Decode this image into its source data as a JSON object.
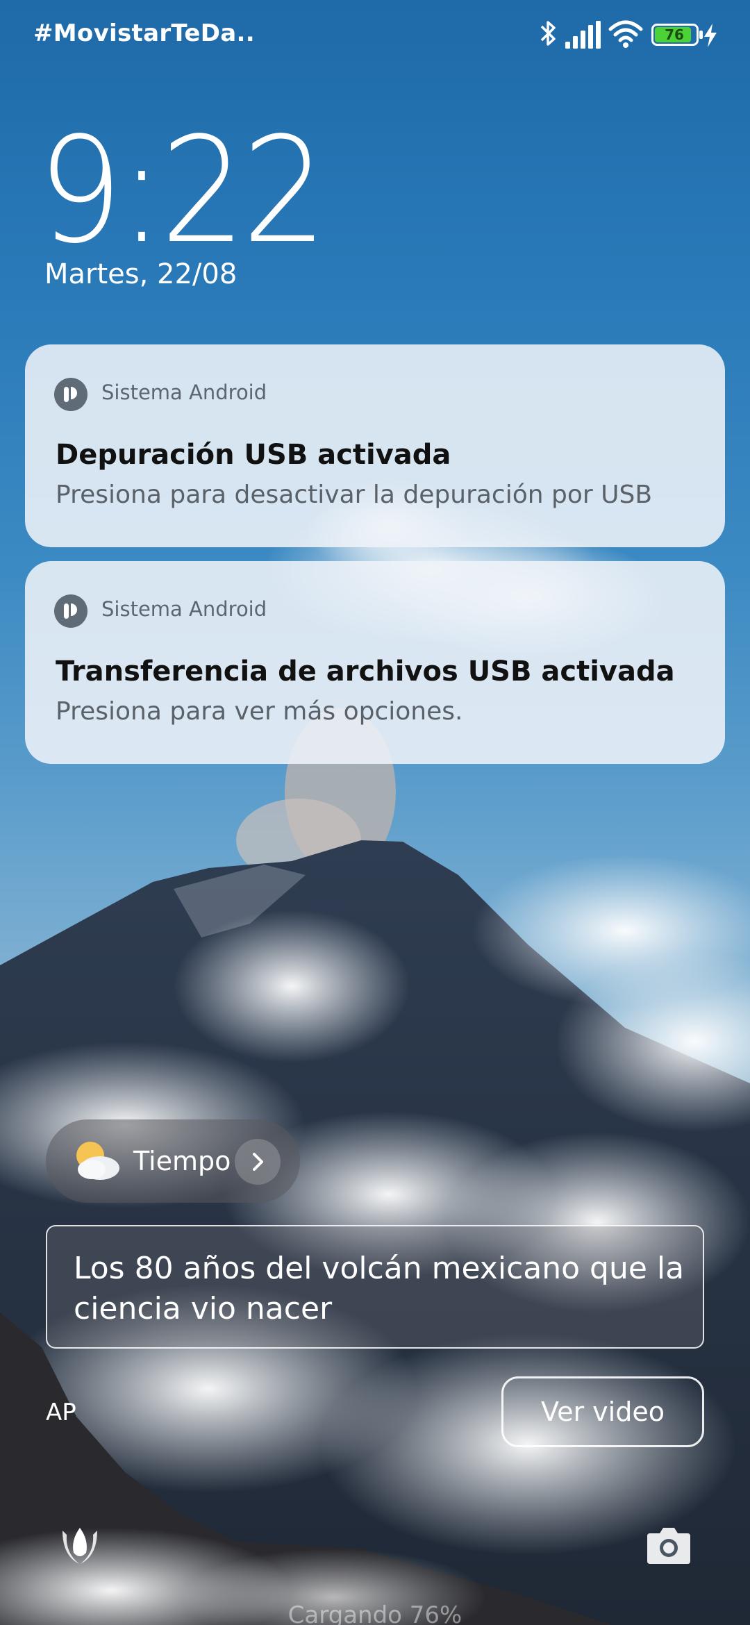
{
  "status_bar": {
    "carrier": "#MovistarTeDa..",
    "battery_level": "76",
    "icons": [
      "bluetooth-icon",
      "signal-icon",
      "wifi-icon",
      "battery-icon",
      "charging-bolt-icon"
    ]
  },
  "lockscreen": {
    "time": "9:22",
    "date": "Martes, 22/08"
  },
  "notifications": [
    {
      "app": "Sistema Android",
      "title": "Depuración USB activada",
      "body": "Presiona para desactivar la depuración por USB"
    },
    {
      "app": "Sistema Android",
      "title": "Transferencia de archivos USB activada",
      "body": "Presiona para ver más opciones."
    }
  ],
  "weather": {
    "label": "Tiempo",
    "icon": "partly-cloudy-icon"
  },
  "wallpaper_story": {
    "headline": "Los 80 años del volcán mexicano que la ciencia vio nacer",
    "credit": "AP",
    "action": "Ver video"
  },
  "footer": {
    "charging_text": "Cargando 76%",
    "left_shortcut": "tulip-icon",
    "right_shortcut": "camera-icon"
  },
  "colors": {
    "notification_bg": "#eef3f8",
    "battery_green": "#4cd137",
    "sky": "#2a7ab9"
  }
}
